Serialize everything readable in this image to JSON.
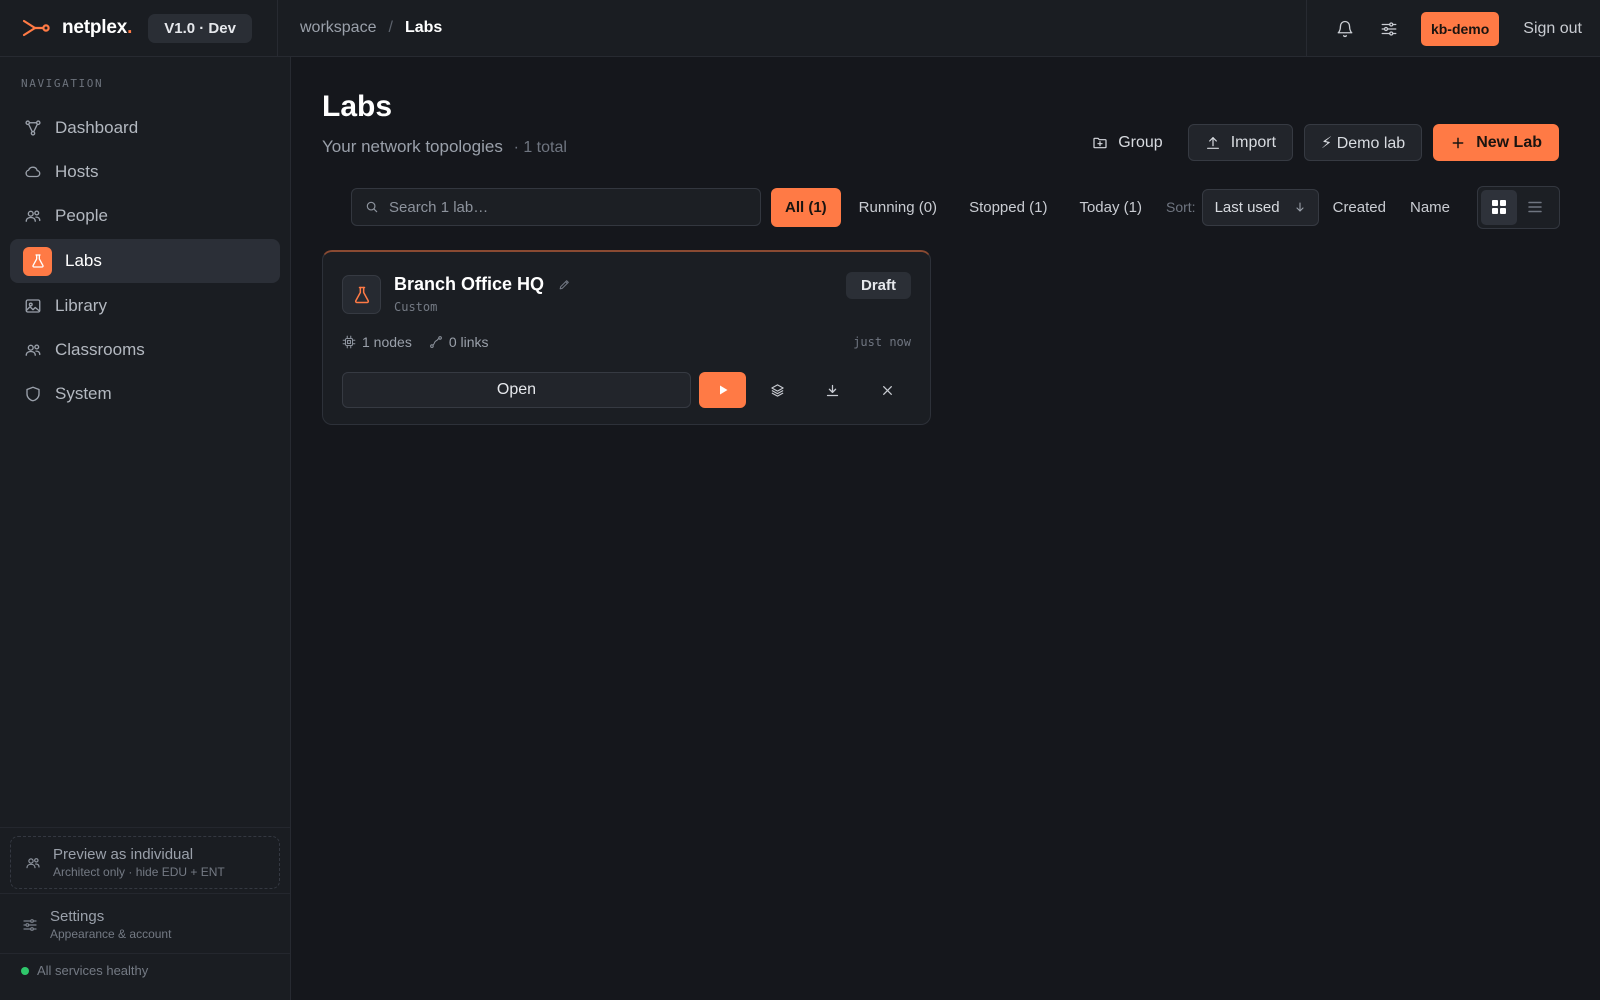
{
  "brand": {
    "name": "netplex",
    "dot": ".",
    "version": "V1.0 · Dev"
  },
  "breadcrumb": {
    "parent": "workspace",
    "separator": "/",
    "current": "Labs"
  },
  "header": {
    "user": "kb-demo",
    "signout": "Sign out"
  },
  "sidebar": {
    "heading": "NAVIGATION",
    "items": [
      {
        "label": "Dashboard",
        "icon": "topology-icon"
      },
      {
        "label": "Hosts",
        "icon": "cloud-icon"
      },
      {
        "label": "People",
        "icon": "people-icon"
      },
      {
        "label": "Labs",
        "icon": "flask-icon",
        "active": true
      },
      {
        "label": "Library",
        "icon": "image-icon"
      },
      {
        "label": "Classrooms",
        "icon": "classroom-icon"
      },
      {
        "label": "System",
        "icon": "shield-icon"
      }
    ],
    "preview": {
      "title": "Preview as individual",
      "subtitle": "Architect only · hide EDU + ENT"
    },
    "settings": {
      "title": "Settings",
      "subtitle": "Appearance & account"
    },
    "health": {
      "text": "All services healthy",
      "color": "#2fc76b"
    }
  },
  "page": {
    "title": "Labs",
    "subtitle": "Your network topologies",
    "count": "· 1 total",
    "actions": {
      "group": "Group",
      "import": "Import",
      "demo": "⚡ Demo lab",
      "new": "New Lab"
    }
  },
  "toolbar": {
    "search_placeholder": "Search 1 lab…",
    "filters": [
      "All (1)",
      "Running (0)",
      "Stopped (1)",
      "Today (1)"
    ],
    "active_filter": "All (1)",
    "sort_label": "Sort:",
    "sort_selected": "Last used",
    "sort_options": [
      "Created",
      "Name"
    ],
    "view": "grid"
  },
  "labs": [
    {
      "name": "Branch Office HQ",
      "type": "Custom",
      "status": "Draft",
      "nodes": "1 nodes",
      "links": "0 links",
      "updated": "just now",
      "open_label": "Open"
    }
  ],
  "colors": {
    "accent": "#ff7a45",
    "background": "#15171c",
    "panel": "#1a1d22"
  }
}
